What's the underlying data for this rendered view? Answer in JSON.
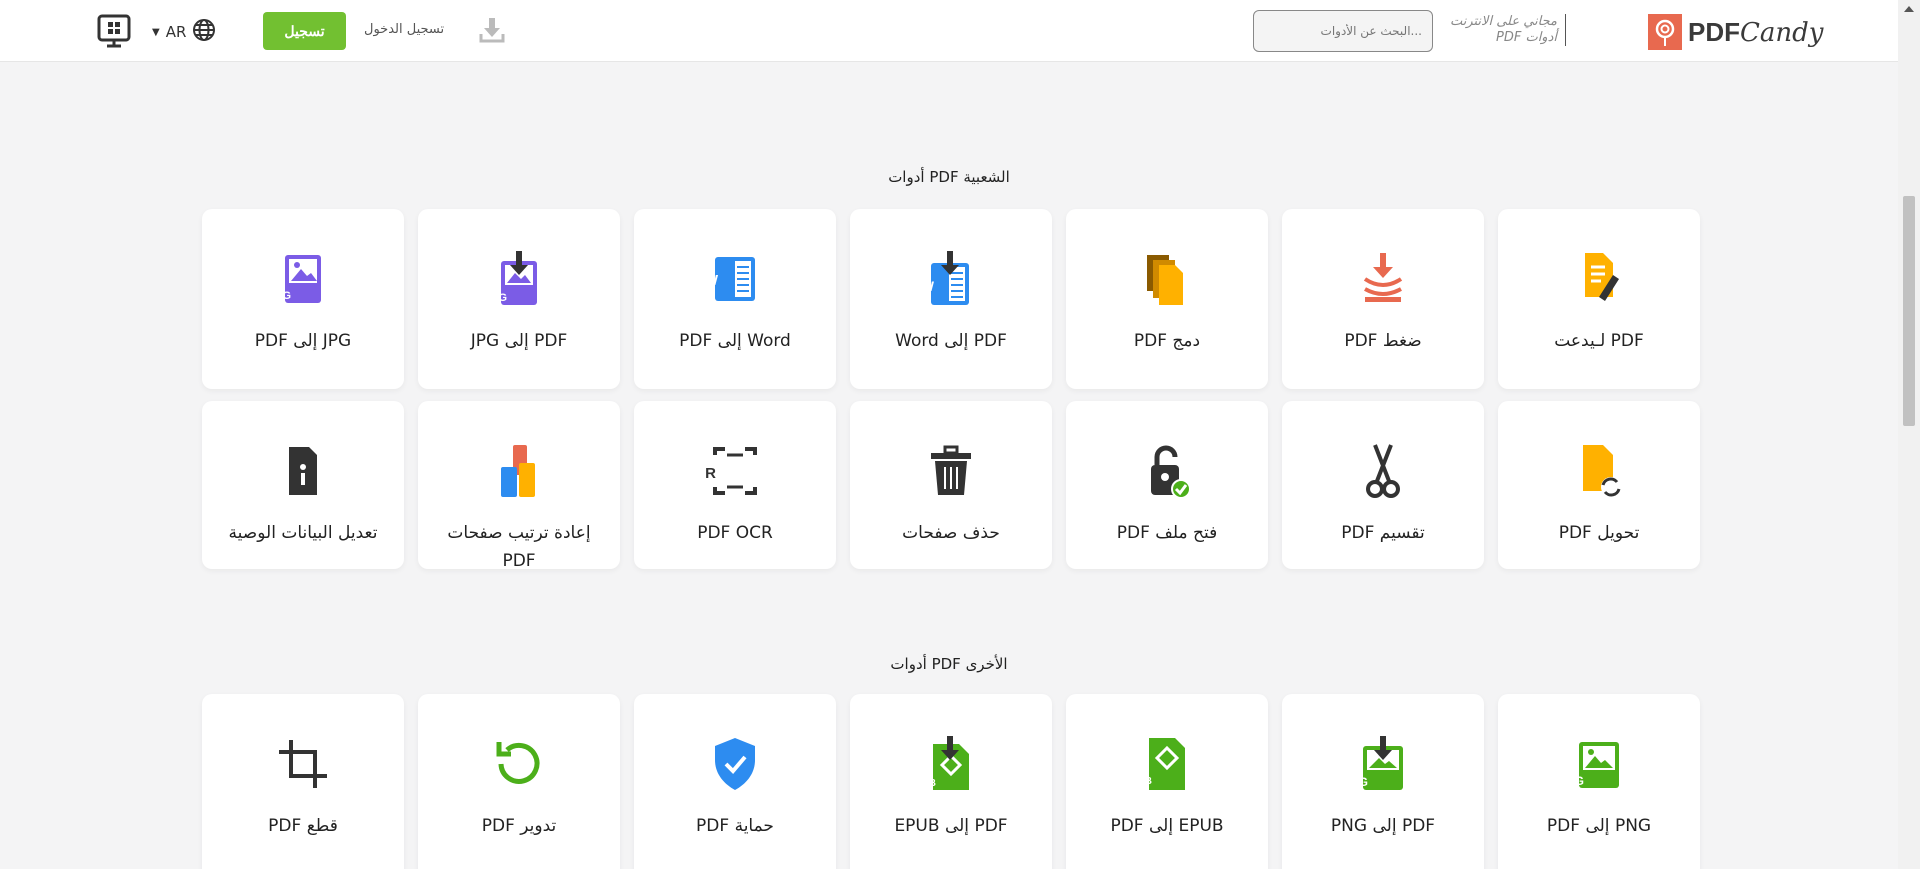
{
  "header": {
    "brand": "PDF",
    "brand_italic": "Candy",
    "tagline_1": "مجاني على الانترنت",
    "tagline_2": "أدوات PDF",
    "search_placeholder": "...البحث عن الأدوات",
    "login": "تسجيل الدخول",
    "signup": "تسجيل",
    "lang": "AR"
  },
  "sections": [
    {
      "title": "أدوات PDF الشعبية"
    },
    {
      "title": "أدوات PDF الأخرى"
    }
  ],
  "popular": [
    {
      "label": "PDF لـيدعت",
      "icon": "edit-pdf-icon"
    },
    {
      "label": "ضغط PDF",
      "icon": "compress-icon"
    },
    {
      "label": "دمج PDF",
      "icon": "merge-icon"
    },
    {
      "label": "PDF إلى Word",
      "icon": "pdf-to-word-icon"
    },
    {
      "label": "Word إلى PDF",
      "icon": "word-icon"
    },
    {
      "label": "PDF إلى JPG",
      "icon": "pdf-to-jpg-icon"
    },
    {
      "label": "JPG إلى PDF",
      "icon": "jpg-icon"
    },
    {
      "label": "تحويل PDF",
      "icon": "convert-icon"
    },
    {
      "label": "تقسيم PDF",
      "icon": "scissors-icon"
    },
    {
      "label": "فتح ملف PDF",
      "icon": "unlock-icon"
    },
    {
      "label": "حذف صفحات",
      "icon": "trash-icon"
    },
    {
      "label": "PDF OCR",
      "icon": "ocr-icon"
    },
    {
      "label": "إعادة ترتيب صفحات PDF",
      "icon": "rearrange-icon"
    },
    {
      "label": "تعديل البيانات الوصية",
      "icon": "info-file-icon"
    }
  ],
  "other": [
    {
      "label": "PNG إلى PDF",
      "icon": "png-icon"
    },
    {
      "label": "PDF إلى PNG",
      "icon": "pdf-to-png-icon"
    },
    {
      "label": "EPUB إلى PDF",
      "icon": "epub-icon"
    },
    {
      "label": "PDF إلى EPUB",
      "icon": "pdf-to-epub-icon"
    },
    {
      "label": "حماية PDF",
      "icon": "shield-icon"
    },
    {
      "label": "تدوير PDF",
      "icon": "rotate-icon"
    },
    {
      "label": "قطع PDF",
      "icon": "crop-icon"
    }
  ],
  "colors": {
    "accent": "#72c031",
    "brand": "#e8694f"
  }
}
